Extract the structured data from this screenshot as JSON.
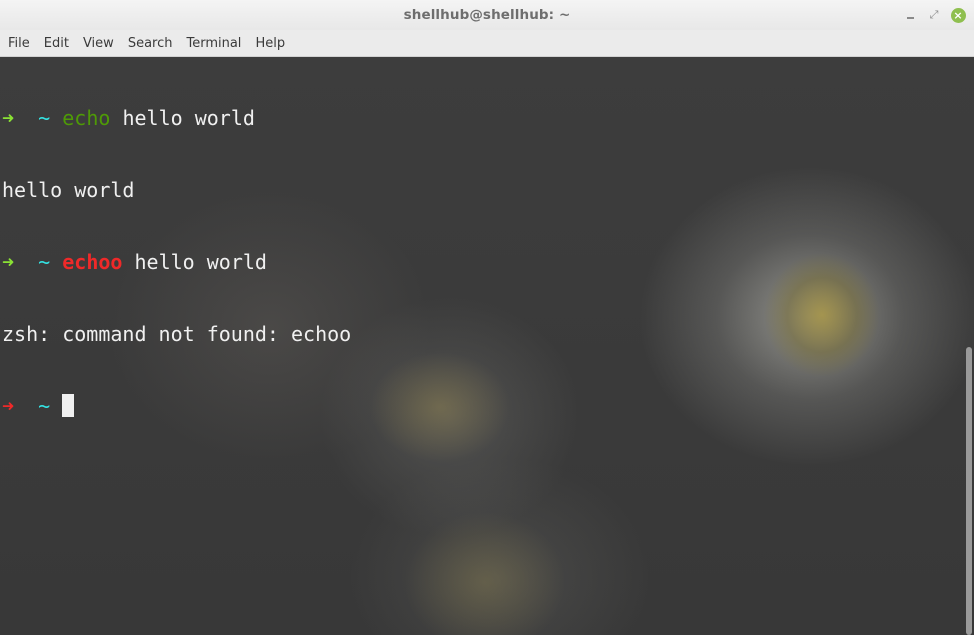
{
  "window": {
    "title": "shellhub@shellhub: ~",
    "controls": {
      "minimize_icon": "minimize-icon",
      "maximize_icon": "restore-icon",
      "close_icon": "close-icon",
      "close_glyph": "×",
      "maximize_glyph": "⤢",
      "close_color": "#8fbf4f"
    }
  },
  "menubar": {
    "items": [
      "File",
      "Edit",
      "View",
      "Search",
      "Terminal",
      "Help"
    ]
  },
  "terminal": {
    "lines": [
      {
        "arrow": "➜",
        "tilde": "~",
        "command": "echo",
        "args": " hello world",
        "status": "ok"
      },
      {
        "output": "hello world"
      },
      {
        "arrow": "➜",
        "tilde": "~",
        "command": "echoo",
        "args": " hello world",
        "status": "ok"
      },
      {
        "output": "zsh: command not found: echoo"
      },
      {
        "arrow": "➜",
        "tilde": "~",
        "status": "err",
        "cursor": true
      }
    ],
    "colors": {
      "arrow_ok": "#8ae234",
      "arrow_err": "#ef2929",
      "tilde": "#34e2e2",
      "command_ok": "#4e9a06",
      "command_err": "#ef2929",
      "text": "#f0f0f0"
    }
  }
}
